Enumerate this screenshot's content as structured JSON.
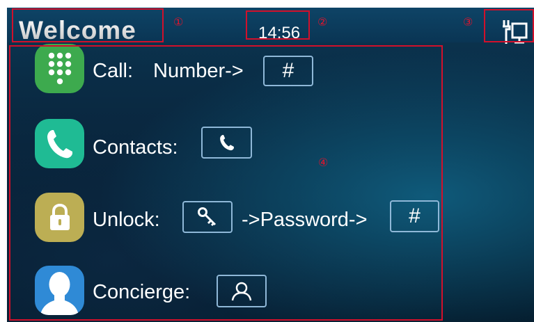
{
  "header": {
    "title": "Welcome",
    "time": "14:56",
    "network_icon": "ethernet-connected-icon"
  },
  "annotations": {
    "m1": "①",
    "m2": "②",
    "m3": "③",
    "m4": "④"
  },
  "menu": {
    "call": {
      "label": "Call:",
      "hint": "Number->",
      "key": "#",
      "icon": "dialpad-icon",
      "icon_color": "#3daa4e"
    },
    "contacts": {
      "label": "Contacts:",
      "icon": "phone-icon",
      "key_icon": "phone-handset-icon",
      "icon_color": "#1fbb94"
    },
    "unlock": {
      "label": "Unlock:",
      "hint": "->Password->",
      "key": "#",
      "icon": "lock-icon",
      "key_icon": "key-icon",
      "icon_color": "#bcae54"
    },
    "concierge": {
      "label": "Concierge:",
      "icon": "person-avatar-icon",
      "key_icon": "person-outline-icon",
      "icon_color": "#2f8ad6"
    }
  },
  "colors": {
    "annotation_red": "#d2102b",
    "screen_bg": "#072238"
  }
}
